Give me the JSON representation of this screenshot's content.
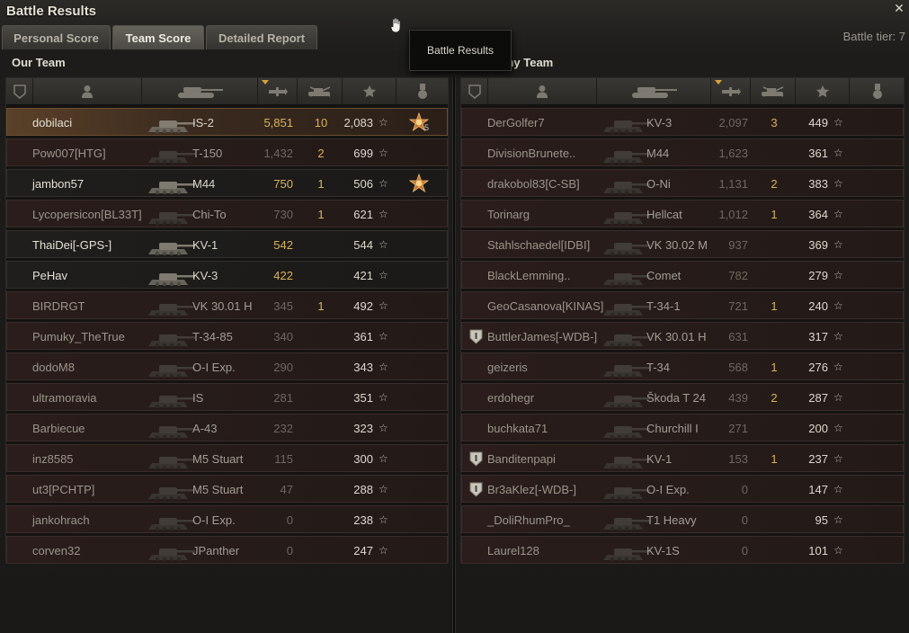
{
  "window": {
    "title": "Battle Results",
    "tier": "Battle tier: 7",
    "tooltip": "Battle Results"
  },
  "tabs": [
    {
      "label": "Personal Score",
      "active": false
    },
    {
      "label": "Team Score",
      "active": true
    },
    {
      "label": "Detailed Report",
      "active": false
    }
  ],
  "teams": {
    "our_title": "Our Team",
    "enemy_title": "Enemy Team"
  },
  "columns": [
    "platoon-icon",
    "player-icon",
    "tank-icon",
    "damage-icon",
    "kills-icon",
    "xp-star-icon",
    "medal-icon"
  ],
  "our_team": [
    {
      "player": "dobilaci",
      "vehicle": "IS-2",
      "damage": "5,851",
      "kills": "10",
      "xp": "2,083",
      "state": "me",
      "dmg_hi": true,
      "medal": "orden",
      "medal_count": "5"
    },
    {
      "player": "Pow007[HTG]",
      "vehicle": "T-150",
      "damage": "1,432",
      "kills": "2",
      "xp": "699",
      "state": "dead",
      "dmg_hi": false
    },
    {
      "player": "jambon57",
      "vehicle": "M44",
      "damage": "750",
      "kills": "1",
      "xp": "506",
      "state": "alive",
      "dmg_hi": true,
      "medal": "orden"
    },
    {
      "player": "Lycopersicon[BL33T]",
      "vehicle": "Chi-To",
      "damage": "730",
      "kills": "1",
      "xp": "621",
      "state": "dead",
      "dmg_hi": false
    },
    {
      "player": "ThaiDei[-GPS-]",
      "vehicle": "KV-1",
      "damage": "542",
      "kills": "",
      "xp": "544",
      "state": "alive",
      "dmg_hi": true
    },
    {
      "player": "PeHav",
      "vehicle": "KV-3",
      "damage": "422",
      "kills": "",
      "xp": "421",
      "state": "alive",
      "dmg_hi": true
    },
    {
      "player": "BIRDRGT",
      "vehicle": "VK 30.01 H",
      "damage": "345",
      "kills": "1",
      "xp": "492",
      "state": "dead",
      "dmg_hi": false
    },
    {
      "player": "Pumuky_TheTrue",
      "vehicle": "T-34-85",
      "damage": "340",
      "kills": "",
      "xp": "361",
      "state": "dead",
      "dmg_hi": false
    },
    {
      "player": "dodoM8",
      "vehicle": "O-I Exp.",
      "damage": "290",
      "kills": "",
      "xp": "343",
      "state": "dead",
      "dmg_hi": false
    },
    {
      "player": "ultramoravia",
      "vehicle": "IS",
      "damage": "281",
      "kills": "",
      "xp": "351",
      "state": "dead",
      "dmg_hi": false
    },
    {
      "player": "Barbiecue",
      "vehicle": "A-43",
      "damage": "232",
      "kills": "",
      "xp": "323",
      "state": "dead",
      "dmg_hi": false
    },
    {
      "player": "inz8585",
      "vehicle": "M5 Stuart",
      "damage": "115",
      "kills": "",
      "xp": "300",
      "state": "dead",
      "dmg_hi": false
    },
    {
      "player": "ut3[PCHTP]",
      "vehicle": "M5 Stuart",
      "damage": "47",
      "kills": "",
      "xp": "288",
      "state": "dead",
      "dmg_hi": false
    },
    {
      "player": "jankohrach",
      "vehicle": "O-I Exp.",
      "damage": "0",
      "kills": "",
      "xp": "238",
      "state": "dead",
      "dmg_hi": false
    },
    {
      "player": "corven32",
      "vehicle": "JPanther",
      "damage": "0",
      "kills": "",
      "xp": "247",
      "state": "dead",
      "dmg_hi": false
    }
  ],
  "enemy_team": [
    {
      "player": "DerGolfer7",
      "vehicle": "KV-3",
      "damage": "2,097",
      "kills": "3",
      "xp": "449",
      "platoon": false
    },
    {
      "player": "DivisionBrunete..",
      "vehicle": "M44",
      "damage": "1,623",
      "kills": "",
      "xp": "361",
      "platoon": false
    },
    {
      "player": "drakobol83[C-SB]",
      "vehicle": "O-Ni",
      "damage": "1,131",
      "kills": "2",
      "xp": "383",
      "platoon": false
    },
    {
      "player": "Torinarg",
      "vehicle": "Hellcat",
      "damage": "1,012",
      "kills": "1",
      "xp": "364",
      "platoon": false
    },
    {
      "player": "Stahlschaedel[IDBI]",
      "vehicle": "VK 30.02 M",
      "damage": "937",
      "kills": "",
      "xp": "369",
      "platoon": false
    },
    {
      "player": "BlackLemming..",
      "vehicle": "Comet",
      "damage": "782",
      "kills": "",
      "xp": "279",
      "platoon": false
    },
    {
      "player": "GeoCasanova[KINAS]",
      "vehicle": "T-34-1",
      "damage": "721",
      "kills": "1",
      "xp": "240",
      "platoon": false
    },
    {
      "player": "ButtlerJames[-WDB-]",
      "vehicle": "VK 30.01 H",
      "damage": "631",
      "kills": "",
      "xp": "317",
      "platoon": true
    },
    {
      "player": "geizeris",
      "vehicle": "T-34",
      "damage": "568",
      "kills": "1",
      "xp": "276",
      "platoon": false
    },
    {
      "player": "erdohegr",
      "vehicle": "Škoda T 24",
      "damage": "439",
      "kills": "2",
      "xp": "287",
      "platoon": false
    },
    {
      "player": "buchkata71",
      "vehicle": "Churchill I",
      "damage": "271",
      "kills": "",
      "xp": "200",
      "platoon": false
    },
    {
      "player": "Banditenpapi",
      "vehicle": "KV-1",
      "damage": "153",
      "kills": "1",
      "xp": "237",
      "platoon": true
    },
    {
      "player": "Br3aKlez[-WDB-]",
      "vehicle": "O-I Exp.",
      "damage": "0",
      "kills": "",
      "xp": "147",
      "platoon": true
    },
    {
      "player": "_DoliRhumPro_",
      "vehicle": "T1 Heavy",
      "damage": "0",
      "kills": "",
      "xp": "95",
      "platoon": false
    },
    {
      "player": "Laurel128",
      "vehicle": "KV-1S",
      "damage": "0",
      "kills": "",
      "xp": "101",
      "platoon": false
    }
  ],
  "colors": {
    "accent": "#d9b35a",
    "dead_row": "#2a1d1b",
    "alive_row": "#1f1e1c"
  }
}
